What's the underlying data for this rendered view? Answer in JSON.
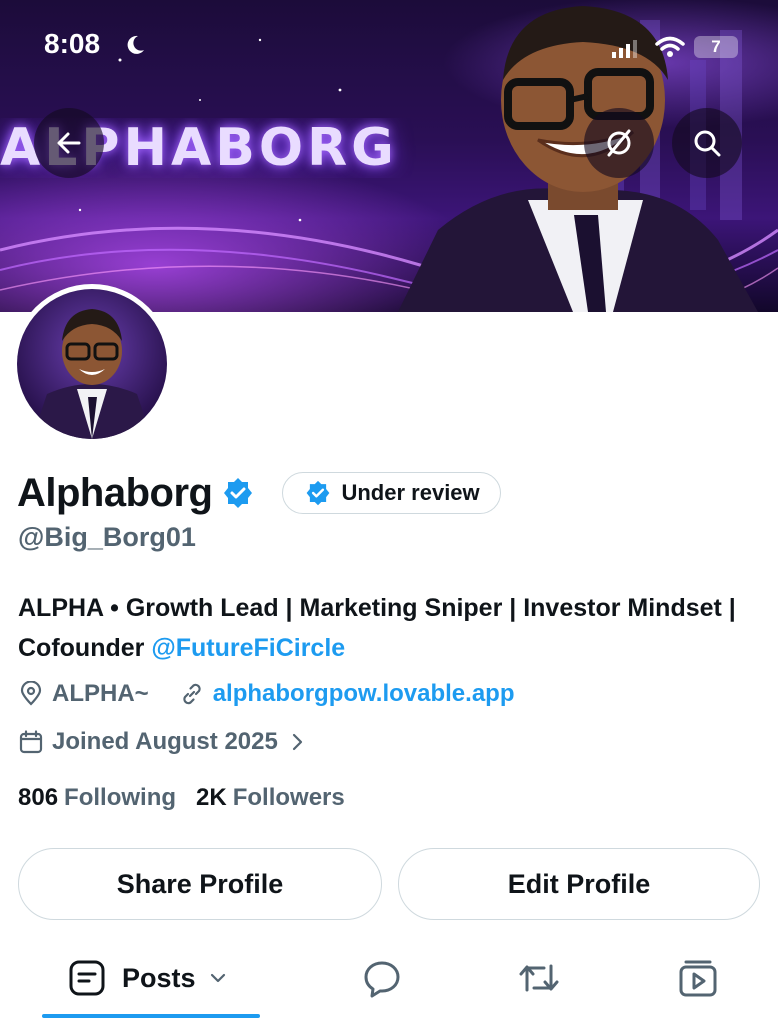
{
  "status_bar": {
    "time": "8:08",
    "battery": "7"
  },
  "banner": {
    "title_text": "ALPHABORG"
  },
  "profile": {
    "display_name": "Alphaborg",
    "review_badge": "Under review",
    "handle": "@Big_Borg01",
    "bio_text": "ALPHA • Growth Lead | Marketing Sniper | Investor Mindset | Cofounder ",
    "bio_mention": "@FutureFiCircle",
    "location": "ALPHA~",
    "website": "alphaborgpow.lovable.app",
    "joined": "Joined August 2025",
    "following_count": "806",
    "following_label": "Following",
    "followers_count": "2K",
    "followers_label": "Followers"
  },
  "actions": {
    "share_label": "Share Profile",
    "edit_label": "Edit Profile"
  },
  "tabs": [
    {
      "label": "Posts",
      "icon": "posts-icon",
      "active": true
    },
    {
      "label": "",
      "icon": "reply-icon"
    },
    {
      "label": "",
      "icon": "repost-icon"
    },
    {
      "label": "",
      "icon": "video-icon"
    }
  ],
  "colors": {
    "accent": "#1d9bf0",
    "secondary_text": "#536471",
    "primary_text": "#0f1419",
    "border": "#cfd9de"
  }
}
